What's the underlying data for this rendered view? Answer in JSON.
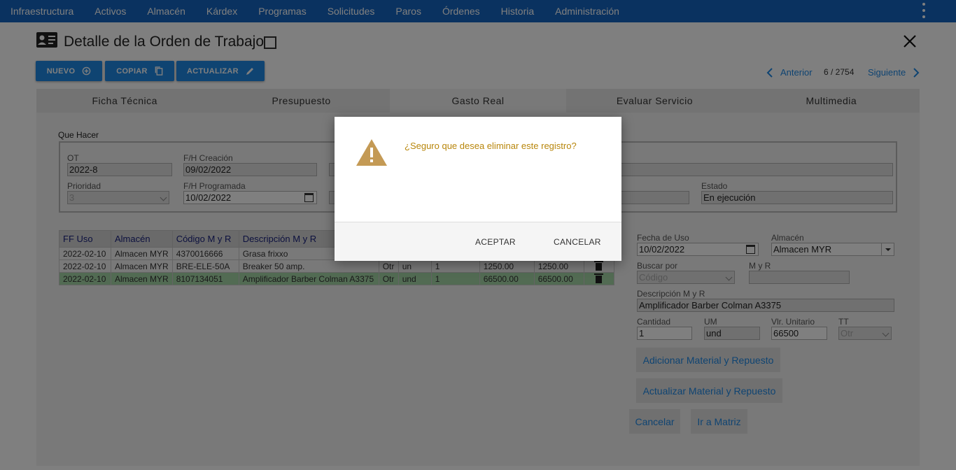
{
  "nav": {
    "items": [
      "Infraestructura",
      "Activos",
      "Almacén",
      "Kárdex",
      "Programas",
      "Solicitudes",
      "Paros",
      "Órdenes",
      "Historia",
      "Administración"
    ]
  },
  "page": {
    "title": "Detalle de la Orden de Trabajo"
  },
  "toolbar": {
    "nuevo": "NUEVO",
    "copiar": "COPIAR",
    "actualizar": "ACTUALIZAR"
  },
  "pager": {
    "prev": "Anterior",
    "count": "6 / 2754",
    "next": "Siguiente"
  },
  "tabs": [
    "Ficha Técnica",
    "Presupuesto",
    "Gasto Real",
    "Evaluar Servicio",
    "Multimedia"
  ],
  "form": {
    "section_label": "Que Hacer",
    "ot_label": "OT",
    "ot_value": "2022-8",
    "fh_creacion_label": "F/H Creación",
    "fh_creacion_value": "09/02/2022",
    "prioridad_label": "Prioridad",
    "prioridad_value": "3",
    "fh_programada_label": "F/H Programada",
    "fh_programada_value": "10/02/2022",
    "estado_label": "Estado",
    "estado_value": "En ejecución"
  },
  "table": {
    "headers": [
      "FF Uso",
      "Almacén",
      "Código M y R",
      "Descripción M y R"
    ],
    "rows": [
      [
        "2022-02-10",
        "Almacen MYR",
        "4370016666",
        "Grasa frixxo",
        "",
        "",
        "",
        "",
        ""
      ],
      [
        "2022-02-10",
        "Almacen MYR",
        "BRE-ELE-50A",
        "Breaker 50 amp.",
        "Otr",
        "un",
        "1",
        "1250.00",
        "1250.00"
      ],
      [
        "2022-02-10",
        "Almacen MYR",
        "8107134051",
        "Amplificador Barber Colman A3375",
        "Otr",
        "und",
        "1",
        "66500.00",
        "66500.00"
      ]
    ]
  },
  "side": {
    "fecha_uso_label": "Fecha de Uso",
    "fecha_uso_value": "10/02/2022",
    "almacen_label": "Almacén",
    "almacen_value": "Almacen MYR",
    "buscar_label": "Buscar por",
    "buscar_value": "Código",
    "myr_label": "M y R",
    "myr_value": "",
    "descripcion_label": "Descripción M y R",
    "descripcion_value": "Amplificador Barber Colman A3375",
    "cantidad_label": "Cantidad",
    "cantidad_value": "1",
    "um_label": "UM",
    "um_value": "und",
    "vlr_label": "Vlr. Unitario",
    "vlr_value": "66500",
    "tt_label": "TT",
    "tt_value": "Otr",
    "adicionar": "Adicionar Material y Repuesto",
    "actualizar": "Actualizar Material y Repuesto",
    "cancelar": "Cancelar",
    "ir_matriz": "Ir a Matriz"
  },
  "modal": {
    "message": "¿Seguro que desea eliminar este registro?",
    "accept": "ACEPTAR",
    "cancel": "CANCELAR",
    "icon": "warning-icon",
    "icon_color": "#c49a55"
  },
  "colors": {
    "nav_bg": "#1565c0",
    "primary": "#1e88e5",
    "selected_row": "#a5d6a7"
  }
}
